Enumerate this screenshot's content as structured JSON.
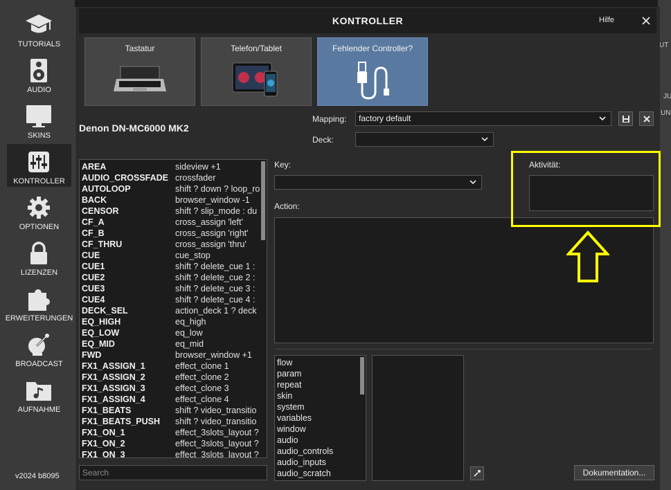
{
  "sidebar": {
    "items": [
      {
        "label": "TUTORIALS",
        "icon": "graduation-cap-icon"
      },
      {
        "label": "AUDIO",
        "icon": "speaker-icon"
      },
      {
        "label": "SKINS",
        "icon": "monitor-icon"
      },
      {
        "label": "KONTROLLER",
        "icon": "sliders-icon",
        "active": true
      },
      {
        "label": "OPTIONEN",
        "icon": "gear-icon"
      },
      {
        "label": "LIZENZEN",
        "icon": "lock-icon"
      },
      {
        "label": "ERWEITERUNGEN",
        "icon": "puzzle-icon"
      },
      {
        "label": "BROADCAST",
        "icon": "satellite-dish-icon"
      },
      {
        "label": "AUFNAHME",
        "icon": "music-folder-icon"
      }
    ],
    "version": "v2024 b8095"
  },
  "right_strip": {
    "t1": "UT",
    "t2": "JU",
    "t3": "UN"
  },
  "dialog": {
    "title": "KONTROLLER",
    "help_label": "Hilfe",
    "tabs": [
      {
        "label": "Tastatur",
        "icon": "laptop-icon"
      },
      {
        "label": "Telefon/Tablet",
        "icon": "tablet-phone-icon"
      },
      {
        "label": "Fehlender Controller?",
        "icon": "usb-cable-icon",
        "active": true
      }
    ],
    "device_name": "Denon DN-MC6000 MK2",
    "mapping_label": "Mapping:",
    "mapping_value": "factory default",
    "deck_label": "Deck:",
    "deck_value": "",
    "key_label": "Key:",
    "key_value": "",
    "action_label": "Action:",
    "activity_label": "Aktivität:",
    "search_placeholder": "Search",
    "doc_button": "Dokumentation...",
    "mappings": [
      {
        "key": "AREA",
        "value": "sideview +1"
      },
      {
        "key": "AUDIO_CROSSFADE",
        "value": "crossfader"
      },
      {
        "key": "AUTOLOOP",
        "value": "shift ? down ? loop_ro"
      },
      {
        "key": "BACK",
        "value": "browser_window -1"
      },
      {
        "key": "CENSOR",
        "value": "shift ? slip_mode : du"
      },
      {
        "key": "CF_A",
        "value": "cross_assign 'left'"
      },
      {
        "key": "CF_B",
        "value": "cross_assign 'right'"
      },
      {
        "key": "CF_THRU",
        "value": "cross_assign 'thru'"
      },
      {
        "key": "CUE",
        "value": "cue_stop"
      },
      {
        "key": "CUE1",
        "value": "shift ? delete_cue 1 :"
      },
      {
        "key": "CUE2",
        "value": "shift ? delete_cue 2 :"
      },
      {
        "key": "CUE3",
        "value": "shift ? delete_cue 3 :"
      },
      {
        "key": "CUE4",
        "value": "shift ? delete_cue 4 :"
      },
      {
        "key": "DECK_SEL",
        "value": "action_deck 1 ? deck"
      },
      {
        "key": "EQ_HIGH",
        "value": "eq_high"
      },
      {
        "key": "EQ_LOW",
        "value": "eq_low"
      },
      {
        "key": "EQ_MID",
        "value": "eq_mid"
      },
      {
        "key": "FWD",
        "value": "browser_window +1"
      },
      {
        "key": "FX1_ASSIGN_1",
        "value": "effect_clone 1"
      },
      {
        "key": "FX1_ASSIGN_2",
        "value": "effect_clone 2"
      },
      {
        "key": "FX1_ASSIGN_3",
        "value": "effect_clone 3"
      },
      {
        "key": "FX1_ASSIGN_4",
        "value": "effect_clone 4"
      },
      {
        "key": "FX1_BEATS",
        "value": "shift ? video_transitio"
      },
      {
        "key": "FX1_BEATS_PUSH",
        "value": "shift ? video_transitio"
      },
      {
        "key": "FX1_ON_1",
        "value": "effect_3slots_layout ?"
      },
      {
        "key": "FX1_ON_2",
        "value": "effect_3slots_layout ?"
      },
      {
        "key": "FX1_ON_3",
        "value": "effect_3slots_layout ?"
      }
    ],
    "categories": [
      "flow",
      "param",
      "repeat",
      "skin",
      "system",
      "variables",
      "window",
      "audio",
      "audio_controls",
      "audio_inputs",
      "audio_scratch"
    ]
  },
  "annotation": {
    "color": "#ffff00"
  }
}
